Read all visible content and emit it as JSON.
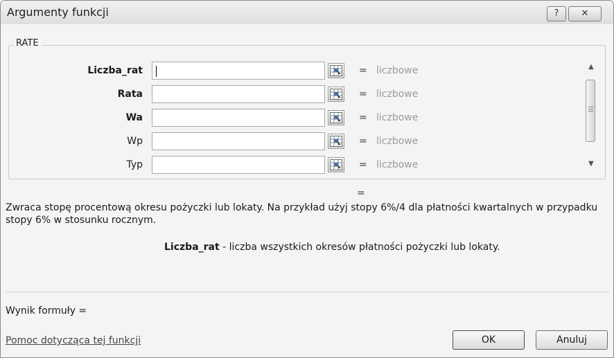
{
  "window": {
    "title": "Argumenty funkcji",
    "help_button": "?",
    "close_button": "✕"
  },
  "function_group": {
    "name": "RATE",
    "arguments": [
      {
        "label": "Liczba_rat",
        "value": "",
        "result_eq": "=",
        "result": "liczbowe",
        "required": true
      },
      {
        "label": "Rata",
        "value": "",
        "result_eq": "=",
        "result": "liczbowe",
        "required": true
      },
      {
        "label": "Wa",
        "value": "",
        "result_eq": "=",
        "result": "liczbowe",
        "required": true
      },
      {
        "label": "Wp",
        "value": "",
        "result_eq": "=",
        "result": "liczbowe",
        "required": false
      },
      {
        "label": "Typ",
        "value": "",
        "result_eq": "=",
        "result": "liczbowe",
        "required": false
      }
    ],
    "scroll_up_icon": "▲",
    "scroll_down_icon": "▼"
  },
  "overall_result": "=",
  "description": "Zwraca stopę procentową okresu pożyczki lub lokaty. Na przykład użyj stopy 6%/4 dla płatności kwartalnych w przypadku stopy 6% w stosunku rocznym.",
  "argument_help": {
    "name": "Liczba_rat",
    "text": " - liczba wszystkich okresów płatności pożyczki lub lokaty."
  },
  "formula_result_label": "Wynik formuły =",
  "help_link": "Pomoc dotycząca tej funkcji",
  "buttons": {
    "ok": "OK",
    "cancel": "Anuluj"
  }
}
